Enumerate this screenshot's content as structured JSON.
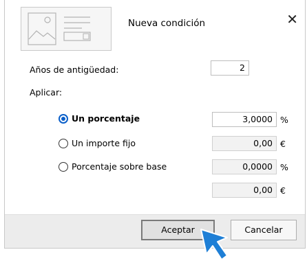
{
  "dialog": {
    "title": "Nueva condición",
    "close_label": "✕"
  },
  "years": {
    "label": "Años de antigüedad:",
    "value": "2"
  },
  "apply": {
    "label": "Aplicar:",
    "options": [
      {
        "label": "Un porcentaje",
        "checked": true,
        "value": "3,0000",
        "unit": "%"
      },
      {
        "label": "Un importe fijo",
        "checked": false,
        "value": "0,00",
        "unit": "€"
      },
      {
        "label": "Porcentaje sobre base",
        "checked": false,
        "value": "0,0000",
        "unit": "%"
      }
    ],
    "base_value": "0,00",
    "base_unit": "€"
  },
  "buttons": {
    "accept": "Aceptar",
    "cancel": "Cancelar"
  },
  "colors": {
    "accent": "#0a5fc9",
    "cursor": "#1e7fd6"
  }
}
